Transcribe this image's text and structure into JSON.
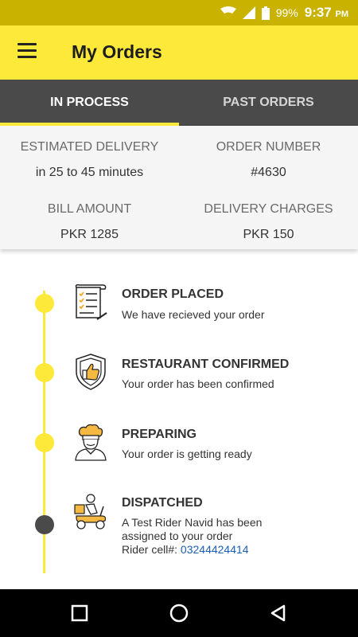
{
  "status_bar": {
    "battery": "99%",
    "time": "9:37",
    "ampm": "PM",
    "icons": [
      "wifi-icon",
      "signal-icon",
      "battery-icon"
    ]
  },
  "app_bar": {
    "title": "My Orders",
    "menu_icon": "hamburger-menu-icon"
  },
  "tabs": [
    {
      "label": "IN PROCESS",
      "active": true
    },
    {
      "label": "PAST ORDERS",
      "active": false
    }
  ],
  "order_info": {
    "estimated_delivery_label": "ESTIMATED DELIVERY",
    "estimated_delivery_value": "in 25 to 45 minutes",
    "order_number_label": "ORDER NUMBER",
    "order_number_value": "#4630",
    "bill_amount_label": "BILL AMOUNT",
    "bill_amount_value": "PKR 1285",
    "delivery_charges_label": "DELIVERY CHARGES",
    "delivery_charges_value": "PKR 150"
  },
  "steps": [
    {
      "title": "ORDER PLACED",
      "desc": "We have recieved your order",
      "icon": "order-list-icon",
      "completed": true
    },
    {
      "title": "RESTAURANT CONFIRMED",
      "desc": "Your order has been confirmed",
      "icon": "thumbs-up-shield-icon",
      "completed": true
    },
    {
      "title": "PREPARING",
      "desc": "Your order is getting ready",
      "icon": "chef-icon",
      "completed": true
    },
    {
      "title": "DISPATCHED",
      "desc_line1": "A Test Rider Navid has been",
      "desc_line2": "assigned to your order",
      "rider_label": "Rider cell#: ",
      "rider_phone": "03244424414",
      "icon": "delivery-scooter-icon",
      "completed": false
    }
  ],
  "colors": {
    "accent": "#fde93a",
    "status_bar": "#c9b200",
    "tab_bar": "#4a4a4a",
    "link": "#1a5fb4"
  },
  "nav_bar": {
    "icons": [
      "recent-apps-icon",
      "home-icon",
      "back-icon"
    ]
  }
}
